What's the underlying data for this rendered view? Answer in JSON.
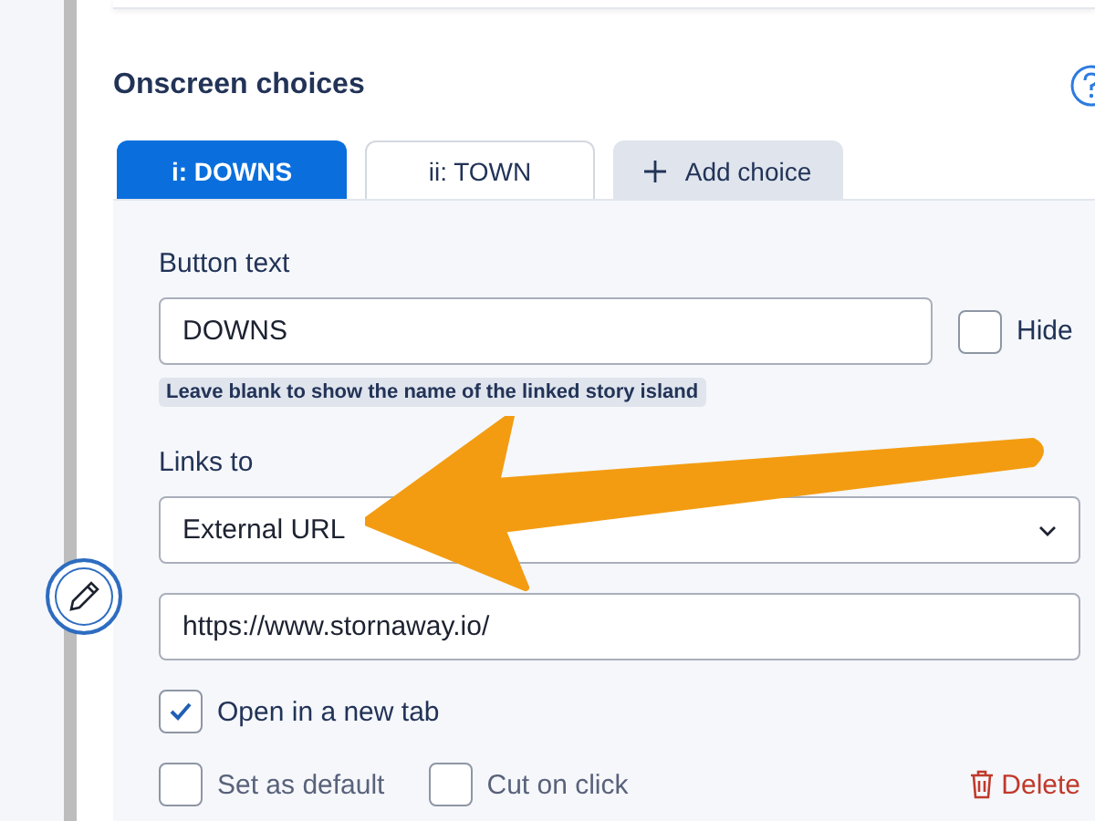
{
  "section": {
    "title": "Onscreen choices"
  },
  "tabs": [
    {
      "label": "i: DOWNS",
      "kind": "choice",
      "selected": true
    },
    {
      "label": "ii: TOWN",
      "kind": "choice",
      "selected": false
    },
    {
      "label": "Add choice",
      "kind": "add",
      "selected": false
    }
  ],
  "button_text": {
    "label": "Button text",
    "value": "DOWNS",
    "hide": {
      "label": "Hide",
      "checked": false
    },
    "hint": "Leave blank to show the name of the linked story island"
  },
  "links_to": {
    "label": "Links to",
    "value": "External URL"
  },
  "url": {
    "value": "https://www.stornaway.io/"
  },
  "options": [
    {
      "label": "Open in a new tab",
      "checked": true
    },
    {
      "label": "Set as default",
      "checked": false
    },
    {
      "label": "Cut on click",
      "checked": false
    }
  ],
  "delete": {
    "label": "Delete"
  }
}
